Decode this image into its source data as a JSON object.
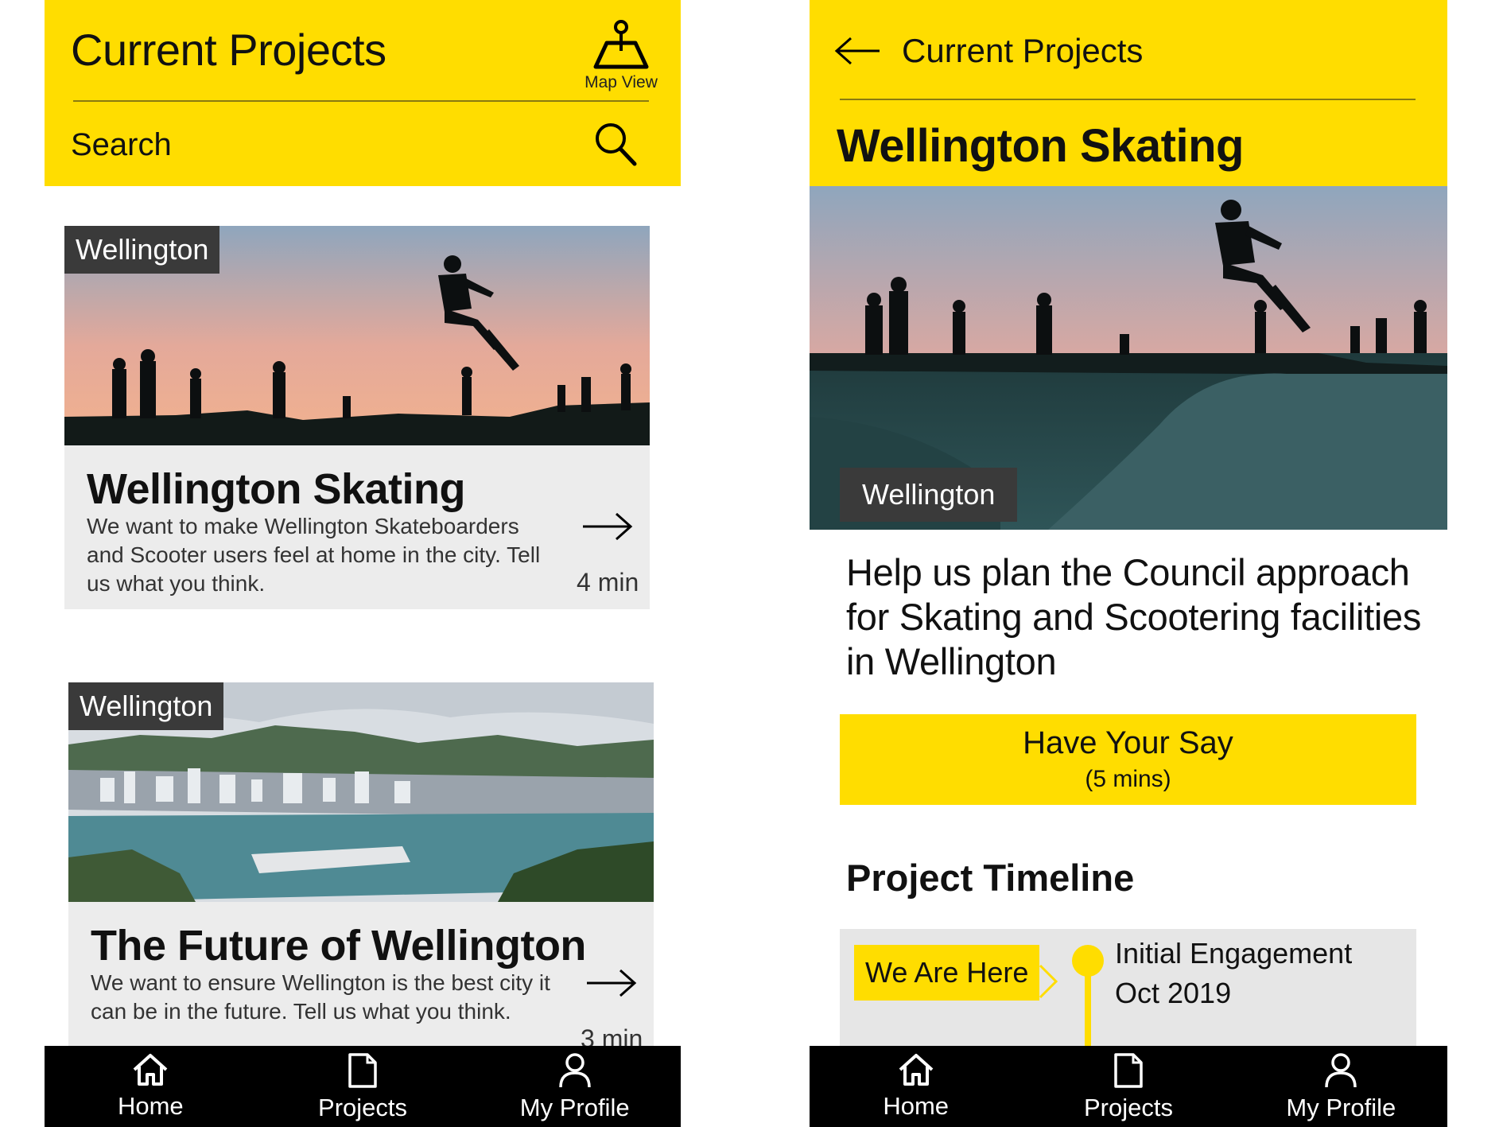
{
  "left": {
    "header": {
      "title": "Current Projects",
      "map_view_label": "Map View",
      "search_label": "Search"
    },
    "cards": [
      {
        "tag": "Wellington",
        "title": "Wellington Skating",
        "description": "We want to make Wellington Skateboarders and Scooter users feel at home in the city. Tell us what you think.",
        "duration": "4 min"
      },
      {
        "tag": "Wellington",
        "title": "The Future of Wellington",
        "description": "We want to ensure Wellington is the best city it can be in the future. Tell us what you think.",
        "duration": "3 min"
      }
    ],
    "nav": [
      {
        "label": "Home",
        "icon": "home-icon"
      },
      {
        "label": "Projects",
        "icon": "document-icon"
      },
      {
        "label": "My Profile",
        "icon": "user-icon"
      }
    ]
  },
  "right": {
    "header": {
      "back_label": "Current Projects",
      "title": "Wellington Skating"
    },
    "hero_tag": "Wellington",
    "description": "Help us plan the Council approach for Skating and Scootering facilities in Wellington",
    "cta": {
      "label": "Have Your Say",
      "sub": "(5 mins)"
    },
    "timeline": {
      "heading": "Project Timeline",
      "badge": "We Are Here",
      "stage": "Initial Engagement",
      "date": "Oct 2019"
    },
    "nav": [
      {
        "label": "Home",
        "icon": "home-icon"
      },
      {
        "label": "Projects",
        "icon": "document-icon"
      },
      {
        "label": "My Profile",
        "icon": "user-icon"
      }
    ]
  },
  "colors": {
    "accent": "#FFDD00",
    "tag_bg": "#3a3a3a",
    "nav_bg": "#000000",
    "card_bg": "#ececec"
  }
}
